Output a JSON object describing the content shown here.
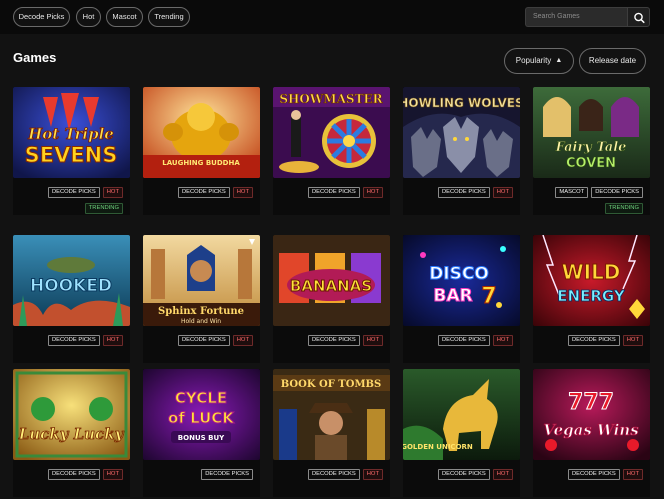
{
  "filters": [
    "Decode Picks",
    "Hot",
    "Mascot",
    "Trending"
  ],
  "search": {
    "placeholder": "Search Games"
  },
  "page_title": "Games",
  "sort": {
    "popularity": "Popularity",
    "release_date": "Release date"
  },
  "games": [
    {
      "art": "Hot Triple SEVENS",
      "tags": [
        "DECODE PICKS",
        "HOT"
      ],
      "tags2": [
        "TRENDING"
      ]
    },
    {
      "art": "LAUGHING BUDDHA",
      "tags": [
        "DECODE PICKS",
        "HOT"
      ],
      "tags2": []
    },
    {
      "art": "SHOWMASTER",
      "tags": [
        "DECODE PICKS",
        "HOT"
      ],
      "tags2": []
    },
    {
      "art": "HOWLING WOLVES",
      "tags": [
        "DECODE PICKS",
        "HOT"
      ],
      "tags2": []
    },
    {
      "art": "Fairy Tale COVEN",
      "tags": [
        "MASCOT",
        "DECODE PICKS"
      ],
      "tags2": [
        "TRENDING"
      ]
    },
    {
      "art": "HOOKED",
      "tags": [
        "DECODE PICKS",
        "HOT"
      ],
      "tags2": []
    },
    {
      "art": "Sphinx Fortune",
      "art2": "Hold and Win",
      "tags": [
        "DECODE PICKS",
        "HOT"
      ],
      "tags2": []
    },
    {
      "art": "BANANAS",
      "tags": [
        "DECODE PICKS",
        "HOT"
      ],
      "tags2": []
    },
    {
      "art": "DISCO BAR",
      "tags": [
        "DECODE PICKS",
        "HOT"
      ],
      "tags2": []
    },
    {
      "art": "WILD ENERGY",
      "tags": [
        "DECODE PICKS",
        "HOT"
      ],
      "tags2": []
    },
    {
      "art": "Lucky Lucky",
      "tags": [
        "DECODE PICKS",
        "HOT"
      ],
      "tags2": []
    },
    {
      "art": "CYCLE of LUCK",
      "art2": "BONUS BUY",
      "tags": [
        "DECODE PICKS"
      ],
      "tags2": []
    },
    {
      "art": "BOOK OF TOMBS",
      "tags": [
        "DECODE PICKS",
        "HOT"
      ],
      "tags2": []
    },
    {
      "art": "GOLDEN UNICORN",
      "tags": [
        "DECODE PICKS",
        "HOT"
      ],
      "tags2": []
    },
    {
      "art": "Vegas Wins",
      "tags": [
        "DECODE PICKS",
        "HOT"
      ],
      "tags2": []
    }
  ],
  "colors": {
    "hot": "#ff6b6b",
    "trending": "#6fd07d",
    "bg": "#121212"
  }
}
